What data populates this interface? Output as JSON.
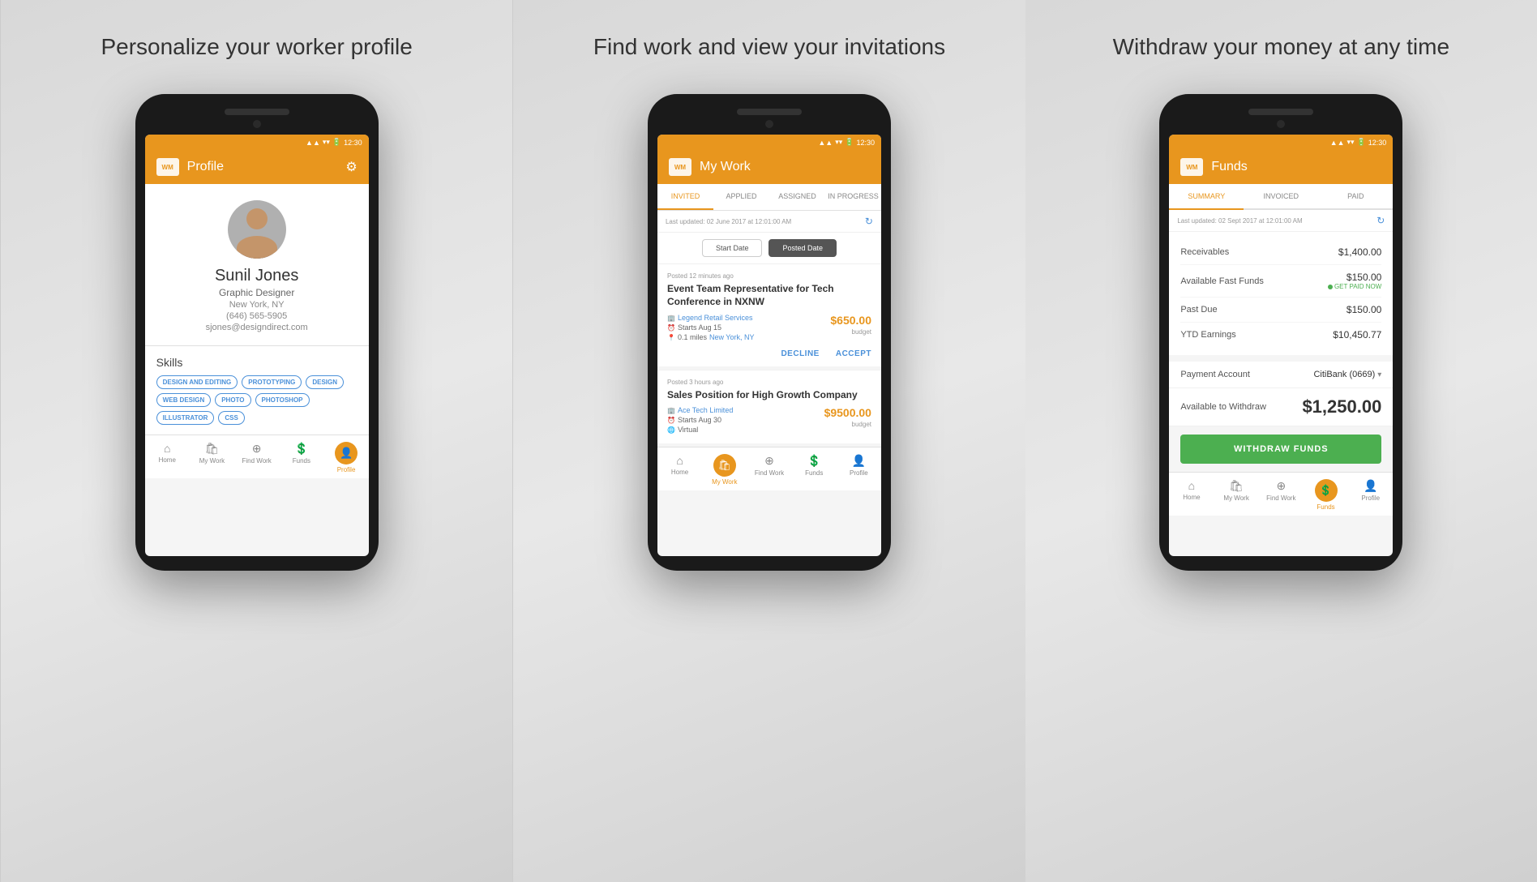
{
  "panels": [
    {
      "id": "profile",
      "title": "Personalize your\nworker profile",
      "screen": {
        "header": {
          "logo": "WM",
          "title": "Profile",
          "icon": "⚙"
        },
        "status_bar": "12:30",
        "user": {
          "name": "Sunil Jones",
          "role": "Graphic Designer",
          "location": "New York, NY",
          "phone": "(646) 565-5905",
          "email": "sjones@designdirect.com"
        },
        "skills_label": "Skills",
        "skills": [
          "DESIGN AND EDITING",
          "PROTOTYPING",
          "DESIGN",
          "WEB DESIGN",
          "PHOTO",
          "PHOTOSHOP",
          "ILLUSTRATOR",
          "CSS"
        ],
        "nav": [
          {
            "label": "Home",
            "icon": "home",
            "active": false
          },
          {
            "label": "My Work",
            "icon": "work",
            "active": false
          },
          {
            "label": "Find Work",
            "icon": "find",
            "active": false
          },
          {
            "label": "Funds",
            "icon": "funds",
            "active": false
          },
          {
            "label": "Profile",
            "icon": "profile",
            "active": true
          }
        ]
      }
    },
    {
      "id": "mywork",
      "title": "Find work and view\nyour invitations",
      "screen": {
        "header": {
          "logo": "WM",
          "title": "My Work"
        },
        "status_bar": "12:30",
        "tabs": [
          {
            "label": "INVITED",
            "active": true
          },
          {
            "label": "APPLIED",
            "active": false
          },
          {
            "label": "ASSIGNED",
            "active": false
          },
          {
            "label": "IN PROGRESS",
            "active": false
          }
        ],
        "last_updated": "Last updated: 02 June 2017 at 12:01:00 AM",
        "sort_buttons": [
          {
            "label": "Start Date",
            "active": false
          },
          {
            "label": "Posted Date",
            "active": true
          }
        ],
        "jobs": [
          {
            "posted": "Posted 12 minutes ago",
            "title": "Event Team Representative for Tech Conference in NXNW",
            "company": "Legend Retail Services",
            "starts": "Starts Aug 15",
            "distance": "0.1 miles",
            "location": "New York, NY",
            "price": "$650.00",
            "price_label": "budget",
            "actions": [
              "DECLINE",
              "ACCEPT"
            ]
          },
          {
            "posted": "Posted 3 hours ago",
            "title": "Sales Position for High Growth Company",
            "company": "Ace Tech Limited",
            "starts": "Starts Aug 30",
            "location_type": "Virtual",
            "price": "$9500.00",
            "price_label": "budget",
            "actions": []
          }
        ],
        "nav": [
          {
            "label": "Home",
            "icon": "home",
            "active": false
          },
          {
            "label": "My Work",
            "icon": "work",
            "active": true
          },
          {
            "label": "Find Work",
            "icon": "find",
            "active": false
          },
          {
            "label": "Funds",
            "icon": "funds",
            "active": false
          },
          {
            "label": "Profile",
            "icon": "profile",
            "active": false
          }
        ]
      }
    },
    {
      "id": "funds",
      "title": "Withdraw your money\nat any time",
      "screen": {
        "header": {
          "logo": "WM",
          "title": "Funds"
        },
        "status_bar": "12:30",
        "tabs": [
          {
            "label": "SUMMARY",
            "active": true
          },
          {
            "label": "INVOICED",
            "active": false
          },
          {
            "label": "PAID",
            "active": false
          }
        ],
        "last_updated": "Last updated: 02 Sept 2017 at 12:01:00 AM",
        "funds_rows": [
          {
            "label": "Receivables",
            "value": "$1,400.00"
          },
          {
            "label": "Available Fast Funds",
            "value": "$150.00",
            "badge": "GET PAID NOW"
          },
          {
            "label": "Past Due",
            "value": "$150.00"
          },
          {
            "label": "YTD Earnings",
            "value": "$10,450.77"
          }
        ],
        "payment_account_label": "Payment Account",
        "payment_account_value": "CitiBank (0669)",
        "withdraw_label": "Available to Withdraw",
        "withdraw_amount": "$1,250.00",
        "withdraw_button": "WITHDRAW FUNDS",
        "nav": [
          {
            "label": "Home",
            "icon": "home",
            "active": false
          },
          {
            "label": "My Work",
            "icon": "work",
            "active": false
          },
          {
            "label": "Find Work",
            "icon": "find",
            "active": false
          },
          {
            "label": "Funds",
            "icon": "funds",
            "active": true
          },
          {
            "label": "Profile",
            "icon": "profile",
            "active": false
          }
        ]
      }
    }
  ],
  "brand_color": "#e8961e",
  "accent_color": "#4a90d9",
  "green_color": "#4caf50"
}
